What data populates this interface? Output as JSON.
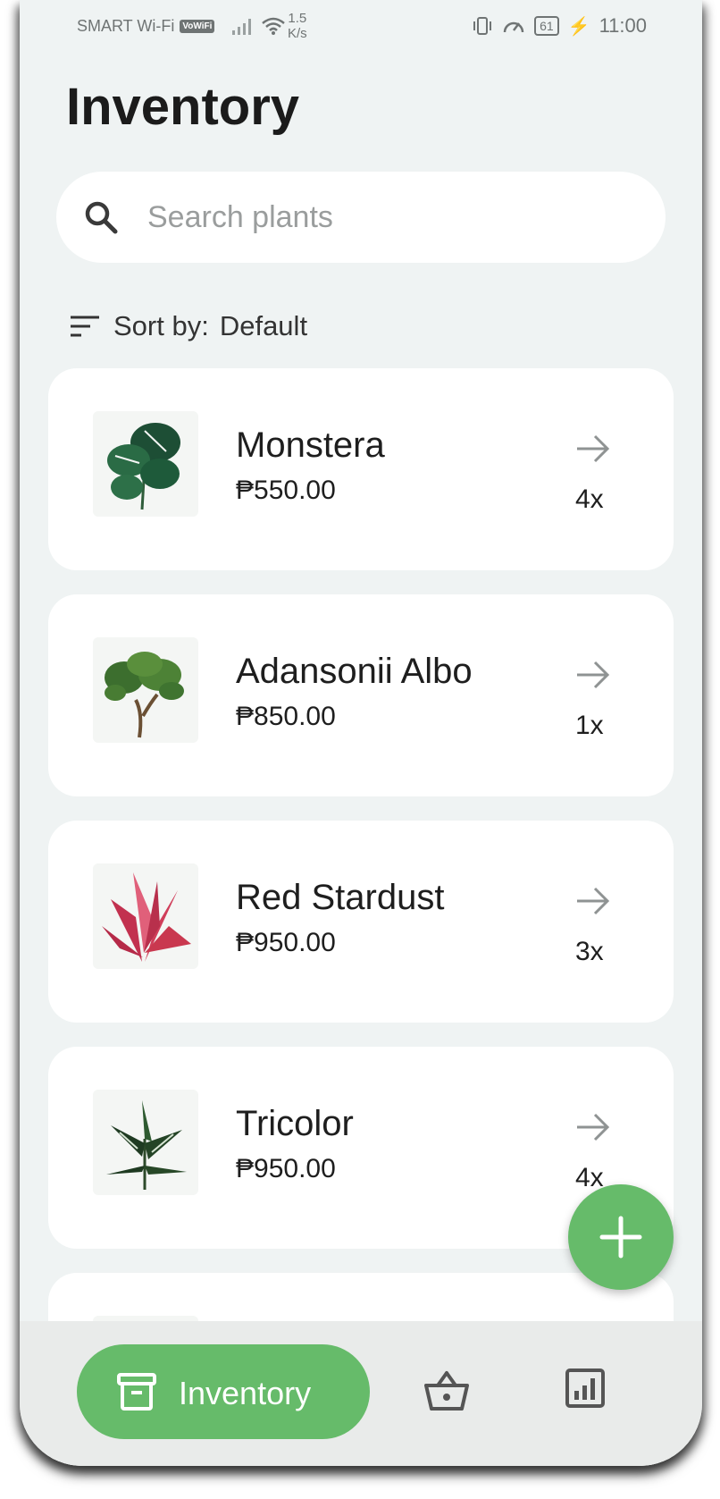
{
  "status_bar": {
    "carrier": "SMART Wi-Fi",
    "vowifi": "VoWiFi",
    "speed_value": "1.5",
    "speed_unit": "K/s",
    "battery": "61",
    "time": "11:00"
  },
  "header": {
    "title": "Inventory"
  },
  "search": {
    "placeholder": "Search plants",
    "value": ""
  },
  "sort": {
    "label": "Sort by:",
    "value": "Default"
  },
  "items": [
    {
      "name": "Monstera",
      "price": "₱550.00",
      "qty": "4x",
      "icon": "monstera-plant-image"
    },
    {
      "name": "Adansonii Albo",
      "price": "₱850.00",
      "qty": "1x",
      "icon": "adansonii-plant-image"
    },
    {
      "name": "Red Stardust",
      "price": "₱950.00",
      "qty": "3x",
      "icon": "red-stardust-plant-image"
    },
    {
      "name": "Tricolor",
      "price": "₱950.00",
      "qty": "4x",
      "icon": "tricolor-plant-image"
    }
  ],
  "nav": {
    "active_label": "Inventory",
    "tabs": [
      "inventory-icon",
      "basket-icon",
      "report-icon"
    ]
  },
  "colors": {
    "accent": "#66bb6a",
    "background": "#eff3f3",
    "card": "#ffffff"
  }
}
